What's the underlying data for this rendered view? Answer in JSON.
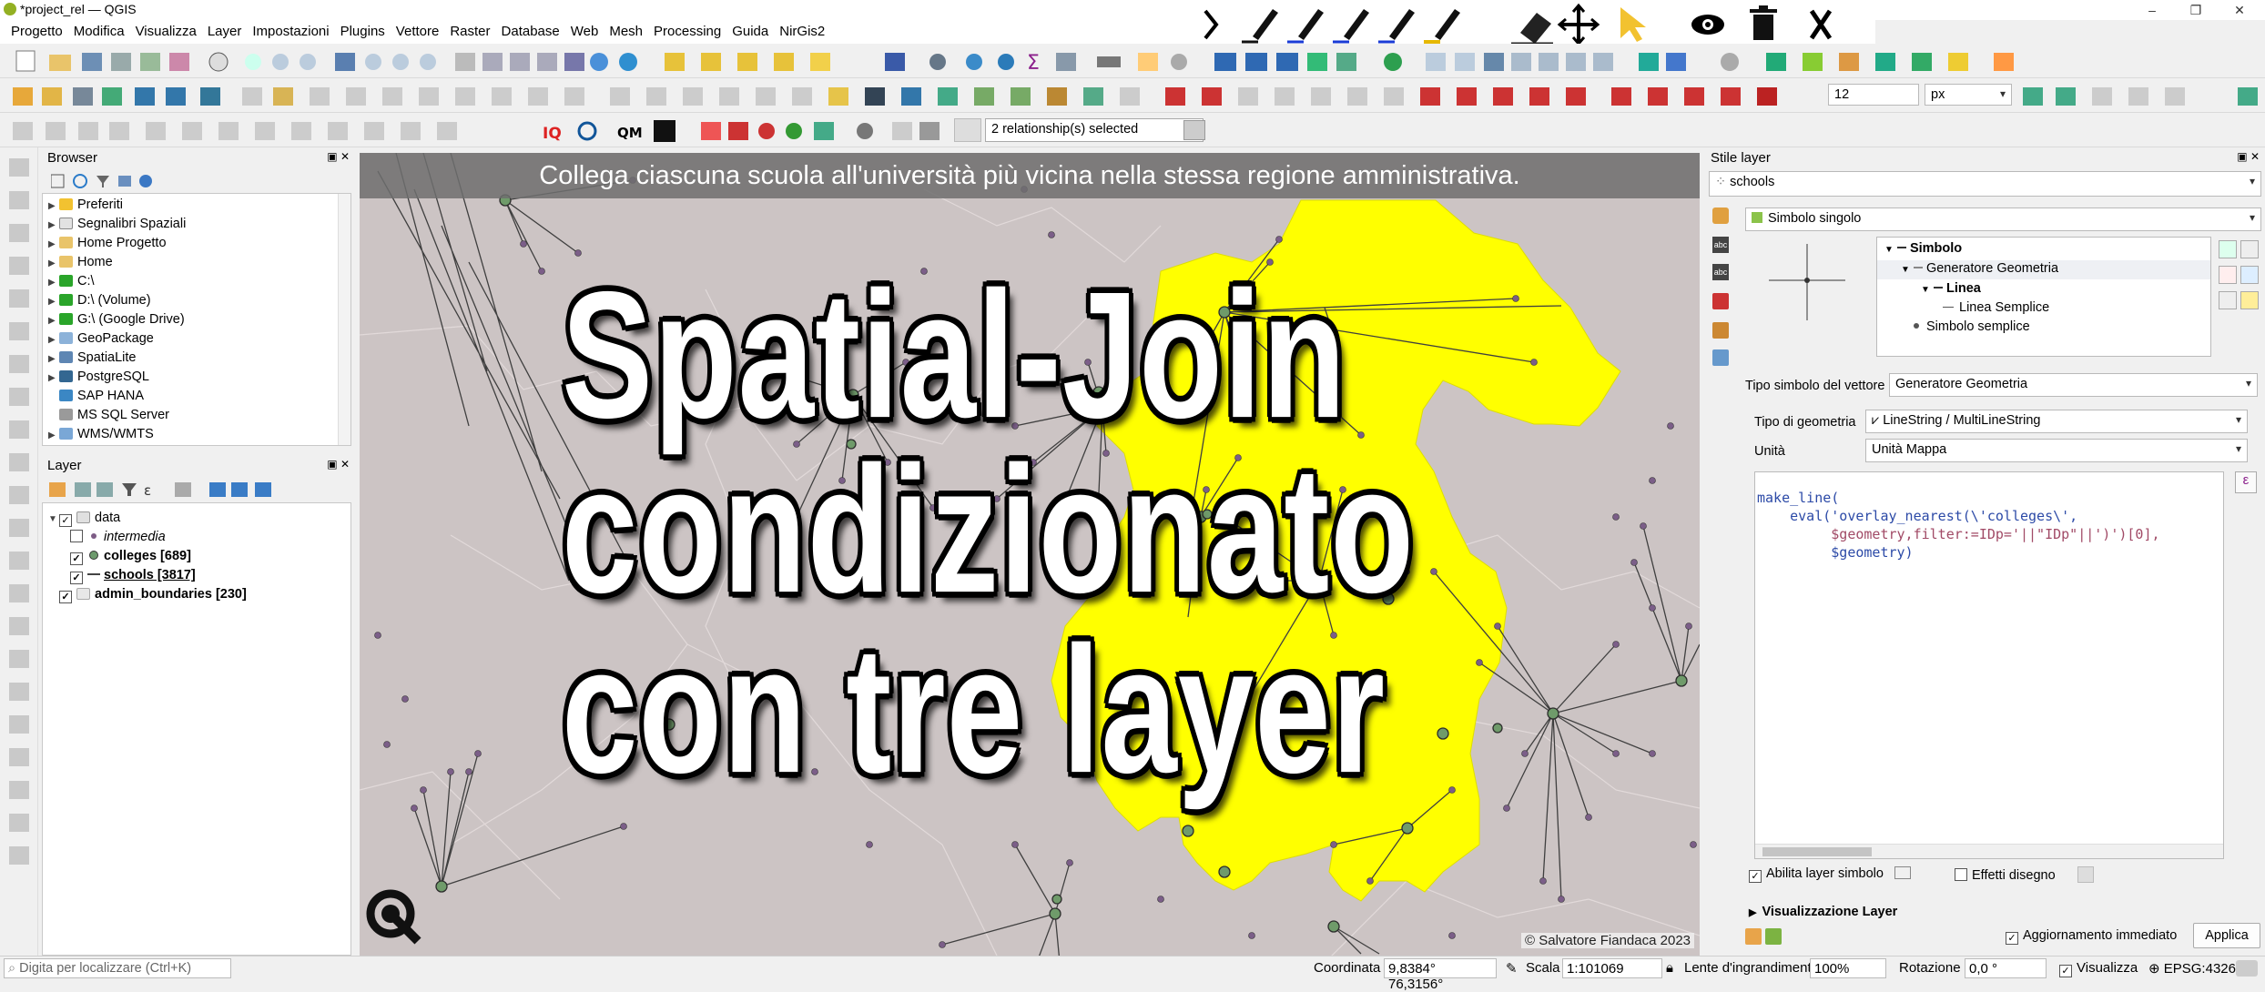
{
  "window": {
    "title": "*project_rel — QGIS",
    "min": "–",
    "restore": "❐",
    "close": "✕"
  },
  "menu": [
    "Progetto",
    "Modifica",
    "Visualizza",
    "Layer",
    "Impostazioni",
    "Plugins",
    "Vettore",
    "Raster",
    "Database",
    "Web",
    "Mesh",
    "Processing",
    "Guida",
    "NirGis2"
  ],
  "toolbar": {
    "relationships": "2 relationship(s) selected",
    "size_value": "12",
    "unit": "px"
  },
  "browser": {
    "title": "Browser",
    "items": [
      "Preferiti",
      "Segnalibri Spaziali",
      "Home Progetto",
      "Home",
      "C:\\",
      "D:\\ (Volume)",
      "G:\\ (Google Drive)",
      "GeoPackage",
      "SpatiaLite",
      "PostgreSQL",
      "SAP HANA",
      "MS SQL Server",
      "WMS/WMTS"
    ]
  },
  "layers": {
    "title": "Layer",
    "items": [
      "data",
      "intermedia",
      "colleges [689]",
      "schools [3817]",
      "admin_boundaries [230]"
    ]
  },
  "map": {
    "banner": "Collega ciascuna scuola all'università più vicina nella stessa regione amministrativa.",
    "line1": "Spatial-Join",
    "line2": "condizionato",
    "line3": "con tre layer",
    "copyright": "© Salvatore Fiandaca 2023",
    "highlight_color": "#ffff00",
    "bg_color": "#ccc4c4"
  },
  "style": {
    "title": "Stile layer",
    "layer": "schools",
    "renderer": "Simbolo singolo",
    "tree": [
      "Simbolo",
      "Generatore Geometria",
      "Linea",
      "Linea Semplice",
      "Simbolo semplice"
    ],
    "symbol_type_label": "Tipo simbolo del vettore",
    "symbol_type_value": "Generatore Geometria",
    "geom_type_label": "Tipo di geometria",
    "geom_type_value": "LineString / MultiLineString",
    "unit_label": "Unità",
    "unit_value": "Unità Mappa",
    "code1": "make_line(",
    "code2": "    eval('overlay_nearest(\\'colleges\\',",
    "code3": "         $geometry,filter:=IDp='||\"IDp\"||')')[0],",
    "code4": "         $geometry)",
    "enable_label": "Abilita layer simbolo",
    "effects_label": "Effetti disegno",
    "viz_label": "Visualizzazione Layer",
    "live_update": "Aggiornamento immediato",
    "apply": "Applica"
  },
  "status": {
    "locate": "Digita per localizzare (Ctrl+K)",
    "coord_label": "Coordinata",
    "coord_value": "9,8384° 76,3156°",
    "scale_label": "Scala",
    "scale_value": "1:101069",
    "zoom_label": "Lente d'ingrandimento",
    "zoom_value": "100%",
    "rot_label": "Rotazione",
    "rot_value": "0,0 °",
    "render_label": "Visualizza",
    "crs": "EPSG:4326"
  }
}
